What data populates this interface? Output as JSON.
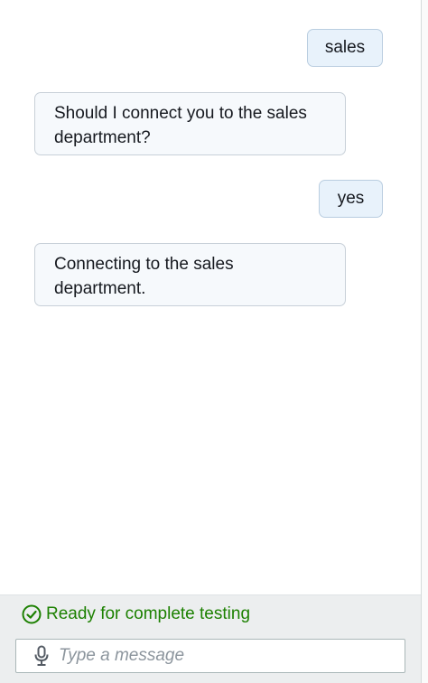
{
  "conversation": {
    "messages": [
      {
        "sender": "user",
        "text": "sales"
      },
      {
        "sender": "bot",
        "text": "Should I connect you to the sales department?"
      },
      {
        "sender": "user",
        "text": "yes"
      },
      {
        "sender": "bot",
        "text": "Connecting to the sales department."
      }
    ]
  },
  "status": {
    "text": "Ready for complete testing",
    "icon": "check-circle-icon",
    "color": "#1d8102"
  },
  "composer": {
    "placeholder": "Type a message",
    "mic_icon": "microphone-icon"
  }
}
